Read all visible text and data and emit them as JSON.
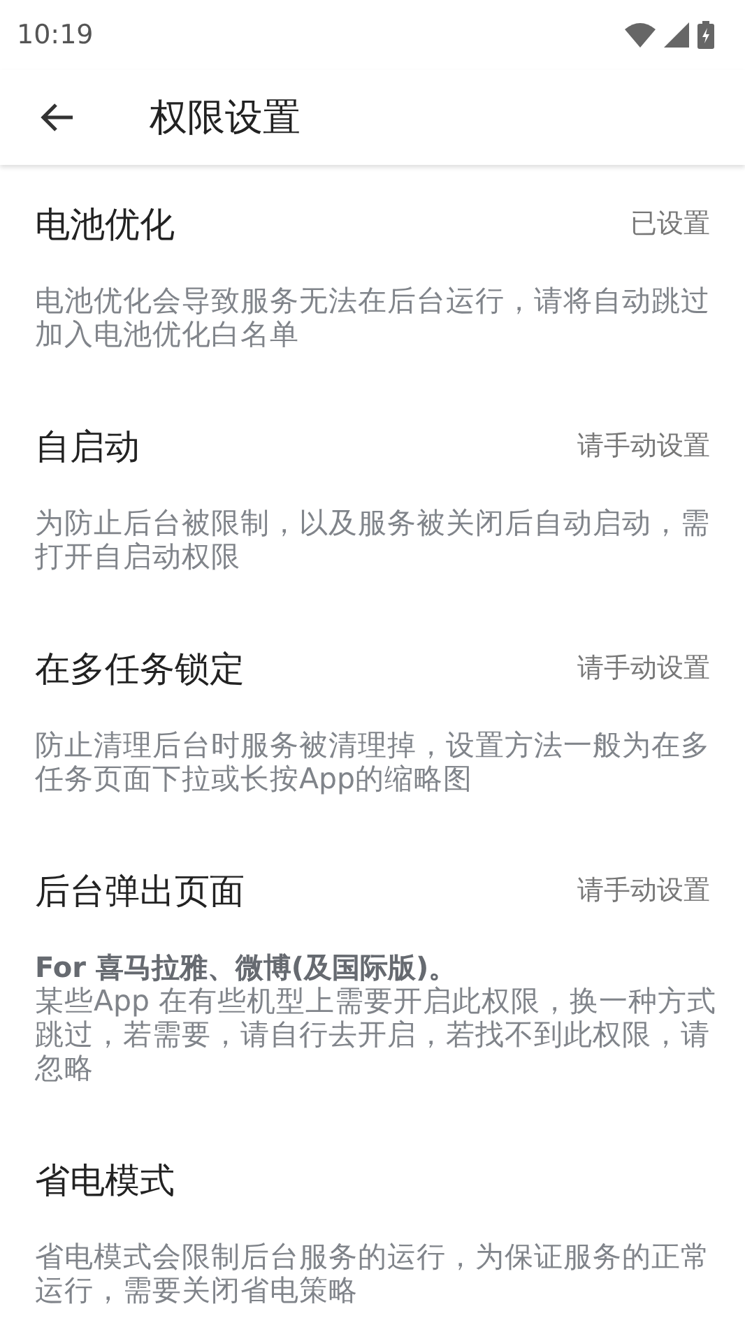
{
  "status_bar": {
    "time": "10:19"
  },
  "toolbar": {
    "title": "权限设置"
  },
  "permissions": [
    {
      "title": "电池优化",
      "status": "已设置",
      "description": "电池优化会导致服务无法在后台运行，请将自动跳过加入电池优化白名单"
    },
    {
      "title": "自启动",
      "status": "请手动设置",
      "description": "为防止后台被限制，以及服务被关闭后自动启动，需打开自启动权限"
    },
    {
      "title": "在多任务锁定",
      "status": "请手动设置",
      "description": "防止清理后台时服务被清理掉，设置方法一般为在多任务页面下拉或长按App的缩略图"
    },
    {
      "title": "后台弹出页面",
      "status": "请手动设置",
      "note": "For 喜马拉雅、微博(及国际版)。",
      "description": "某些App 在有些机型上需要开启此权限，换一种方式跳过，若需要，请自行去开启，若找不到此权限，请忽略"
    },
    {
      "title": "省电模式",
      "description": "省电模式会限制后台服务的运行，为保证服务的正常运行，需要关闭省电策略"
    }
  ]
}
